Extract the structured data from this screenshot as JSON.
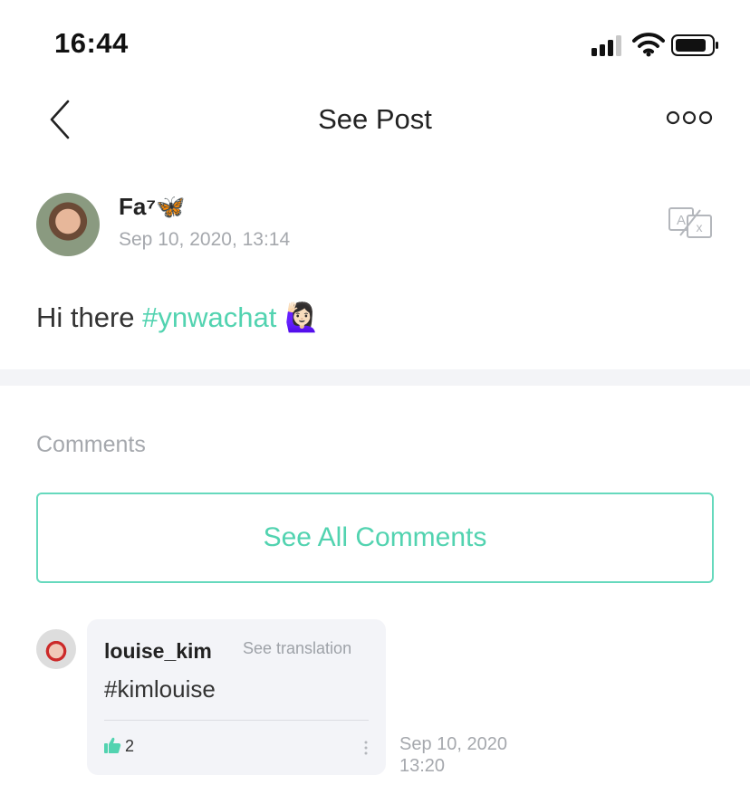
{
  "status_bar": {
    "time": "16:44"
  },
  "nav": {
    "title": "See Post"
  },
  "post": {
    "author": "Fa⁷🦋",
    "date": "Sep 10, 2020, 13:14",
    "text_plain": "Hi there ",
    "hashtag": "#ynwachat",
    "emoji": "🙋🏻‍♀️"
  },
  "comments": {
    "label": "Comments",
    "see_all": "See All Comments",
    "items": [
      {
        "user": "louise_kim",
        "see_translation": "See translation",
        "text": "#kimlouise",
        "likes": "2",
        "date_line1": "Sep 10, 2020",
        "date_line2": "13:20"
      }
    ]
  },
  "colors": {
    "accent": "#52d3b0",
    "muted": "#a5a8ad",
    "band": "#f3f4f7"
  }
}
